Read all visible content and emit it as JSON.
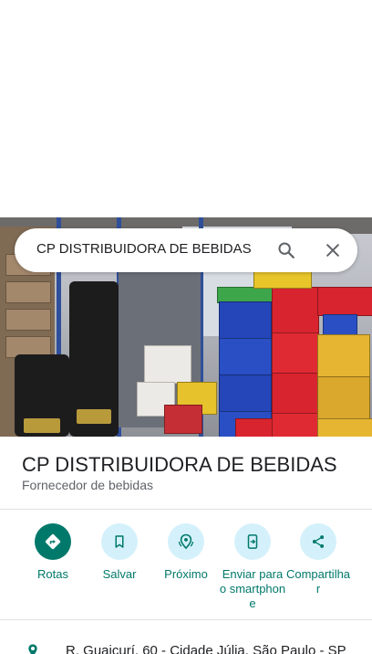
{
  "search": {
    "query": "CP DISTRIBUIDORA DE BEBIDAS",
    "search_icon": "search-icon",
    "clear_icon": "close-icon"
  },
  "place": {
    "name": "CP DISTRIBUIDORA DE BEBIDAS",
    "category": "Fornecedor de bebidas",
    "photo": "warehouse-photo"
  },
  "actions": [
    {
      "label": "Rotas",
      "icon": "directions-icon"
    },
    {
      "label": "Salvar",
      "icon": "bookmark-icon"
    },
    {
      "label": "Próximo",
      "icon": "nearby-icon"
    },
    {
      "label": "Enviar para o smartphone",
      "icon": "send-to-phone-icon"
    },
    {
      "label": "Compartilhar",
      "icon": "share-icon"
    }
  ],
  "address": {
    "text": "R. Guaicurí, 60 - Cidade Júlia, São Paulo - SP",
    "icon": "location-pin-icon"
  },
  "colors": {
    "accent": "#00796b",
    "action_circle": "#d4f1fb",
    "text_primary": "#202124",
    "text_secondary": "#5f6368"
  }
}
